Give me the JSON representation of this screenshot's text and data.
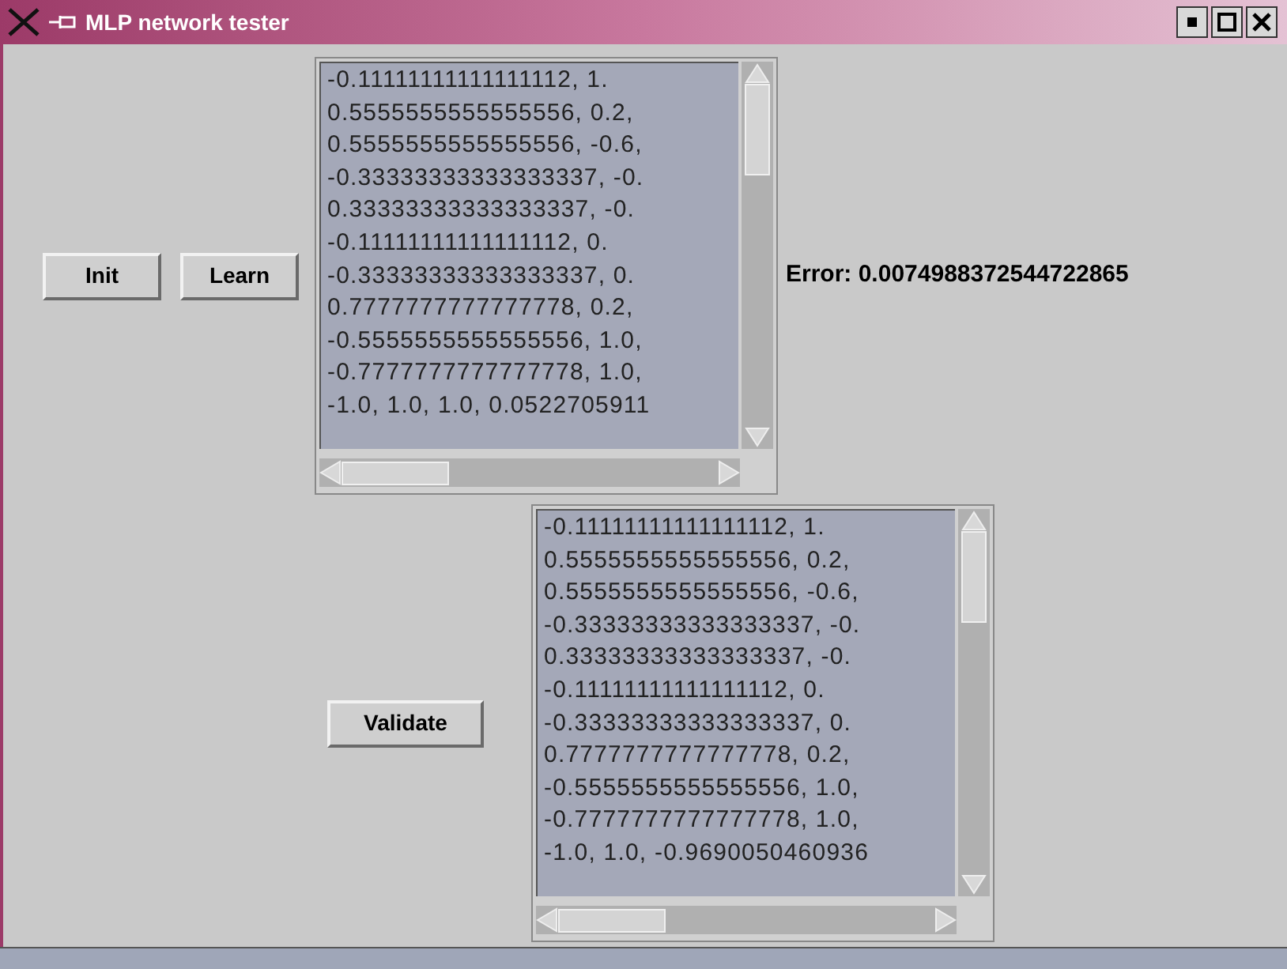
{
  "window": {
    "title": "MLP network tester"
  },
  "top_buttons": [
    {
      "label": "Init"
    },
    {
      "label": "Learn"
    }
  ],
  "training_output": {
    "lines": [
      "-0.11111111111111112, 1.",
      "0.5555555555555556, 0.2,",
      "0.5555555555555556, -0.6,",
      "-0.33333333333333337, -0.",
      "0.33333333333333337, -0.",
      "-0.11111111111111112, 0.",
      "-0.33333333333333337, 0.",
      "0.7777777777777778, 0.2,",
      "-0.5555555555555556, 1.0,",
      "-0.7777777777777778, 1.0,",
      "-1.0, 1.0, 1.0, 0.0522705911"
    ]
  },
  "error_label": "Error: 0.0074988372544722865",
  "validate_button": {
    "label": "Validate"
  },
  "validation_output": {
    "lines": [
      "-0.11111111111111112, 1.",
      "0.5555555555555556, 0.2,",
      "0.5555555555555556, -0.6,",
      "-0.33333333333333337, -0.",
      "0.33333333333333337, -0.",
      "-0.11111111111111112, 0.",
      "-0.33333333333333337, 0.",
      "0.7777777777777778, 0.2,",
      "-0.5555555555555556, 1.0,",
      "-0.7777777777777778, 1.0,",
      "-1.0, 1.0, -0.9690050460936"
    ]
  }
}
